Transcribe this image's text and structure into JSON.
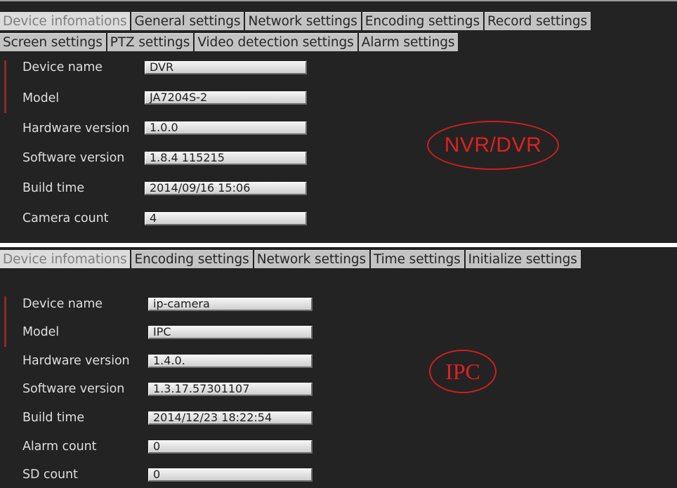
{
  "nvr": {
    "tabs_row1": [
      "Device infomations",
      "General settings",
      "Network settings",
      "Encoding settings",
      "Record settings"
    ],
    "tabs_row2": [
      "Screen settings",
      "PTZ settings",
      "Video detection settings",
      "Alarm settings"
    ],
    "active_tab": "Device infomations",
    "fields": [
      {
        "label": "Device name",
        "value": "DVR"
      },
      {
        "label": "Model",
        "value": "JA7204S-2"
      },
      {
        "label": "Hardware version",
        "value": "1.0.0"
      },
      {
        "label": "Software version",
        "value": "1.8.4 115215"
      },
      {
        "label": "Build time",
        "value": "2014/09/16 15:06"
      },
      {
        "label": "Camera count",
        "value": "4"
      }
    ],
    "stamp": "NVR/DVR"
  },
  "ipc": {
    "tabs": [
      "Device infomations",
      "Encoding settings",
      "Network settings",
      "Time settings",
      "Initialize settings"
    ],
    "active_tab": "Device infomations",
    "fields": [
      {
        "label": "Device name",
        "value": "ip-camera"
      },
      {
        "label": "Model",
        "value": "IPC"
      },
      {
        "label": "Hardware version",
        "value": "1.4.0."
      },
      {
        "label": "Software version",
        "value": "1.3.17.57301107"
      },
      {
        "label": "Build time",
        "value": "2014/12/23  18:22:54"
      },
      {
        "label": "Alarm count",
        "value": "0"
      },
      {
        "label": "SD count",
        "value": "0"
      }
    ],
    "stamp": "IPC"
  },
  "colors": {
    "panel_bg": "#232323",
    "tab_bg": "#c3c3c3",
    "active_tab_text": "#7f7f7f",
    "label_text": "#dedede",
    "stamp_red": "#d21d1d"
  }
}
